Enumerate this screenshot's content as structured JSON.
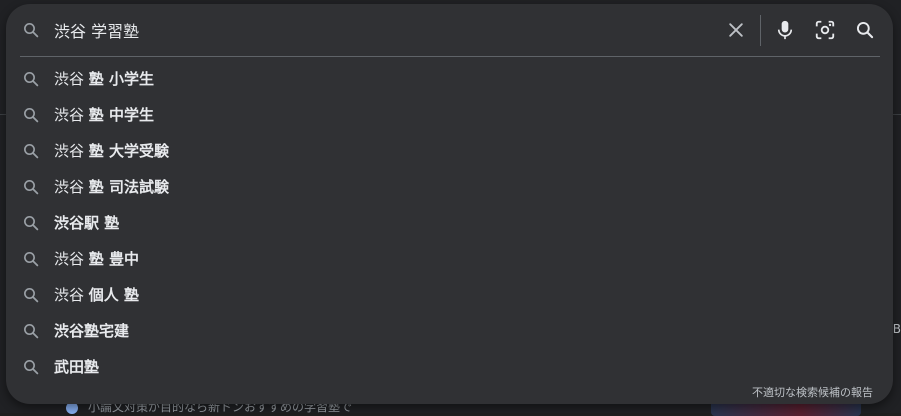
{
  "search": {
    "query": "渋谷 学習塾",
    "clear_icon": "close-icon",
    "mic_icon": "mic-icon",
    "lens_icon": "lens-icon",
    "search_icon": "search-icon"
  },
  "suggestions": [
    {
      "plain": "渋谷 ",
      "bold": "塾 小学生"
    },
    {
      "plain": "渋谷 ",
      "bold": "塾 中学生"
    },
    {
      "plain": "渋谷 ",
      "bold": "塾 大学受験"
    },
    {
      "plain": "渋谷 ",
      "bold": "塾 司法試験"
    },
    {
      "plain": "",
      "bold": "渋谷駅 塾"
    },
    {
      "plain": "渋谷 ",
      "bold": "塾 豊中"
    },
    {
      "plain": "渋谷 ",
      "bold": "個人 塾"
    },
    {
      "plain": "",
      "bold": "渋谷塾宅建"
    },
    {
      "plain": "",
      "bold": "武田塾"
    }
  ],
  "report_link": "不適切な検索候補の報告",
  "background": {
    "peek_text": "小論文対策が目的なら新ドンおすすめの学習塾で",
    "edge_text": "B"
  },
  "colors": {
    "popup_bg": "#303134",
    "text": "#e8eaed",
    "icon": "#9aa0a6",
    "divider": "#5f6368"
  }
}
